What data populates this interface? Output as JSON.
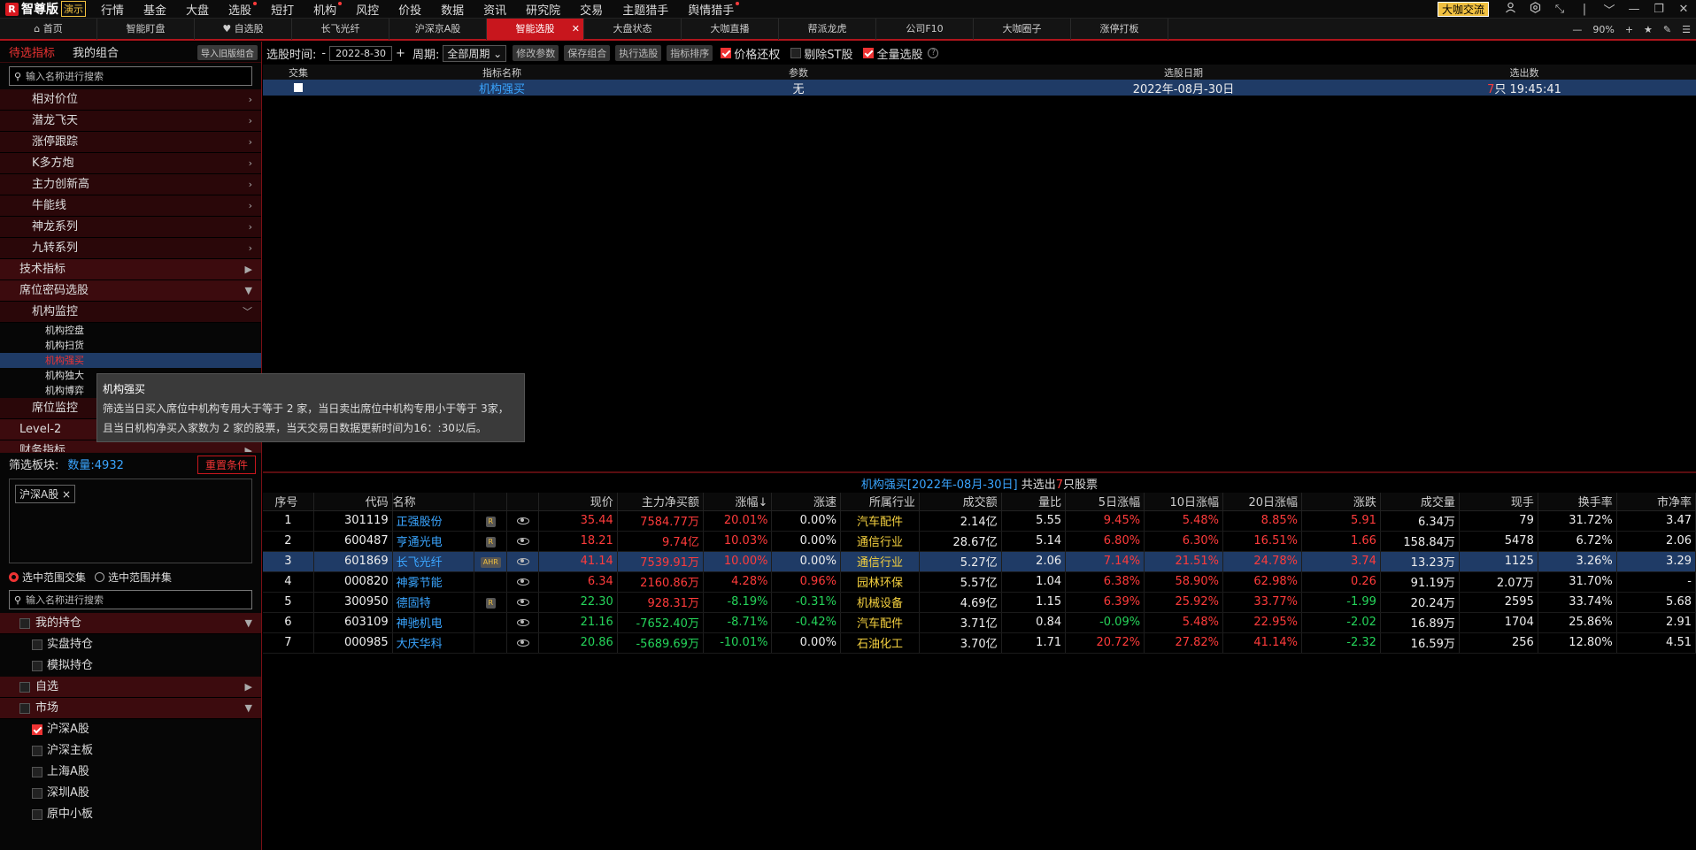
{
  "app": {
    "name": "智尊版",
    "demo_tag": "演示",
    "logo_letter": "R"
  },
  "menu": [
    {
      "label": "行情",
      "dot": false
    },
    {
      "label": "基金",
      "dot": false
    },
    {
      "label": "大盘",
      "dot": false
    },
    {
      "label": "选股",
      "dot": true
    },
    {
      "label": "短打",
      "dot": false
    },
    {
      "label": "机构",
      "dot": true
    },
    {
      "label": "风控",
      "dot": false
    },
    {
      "label": "价投",
      "dot": false
    },
    {
      "label": "数据",
      "dot": false
    },
    {
      "label": "资讯",
      "dot": false
    },
    {
      "label": "研究院",
      "dot": false
    },
    {
      "label": "交易",
      "dot": false
    },
    {
      "label": "主题猎手",
      "dot": false
    },
    {
      "label": "舆情猎手",
      "dot": true
    }
  ],
  "menu_right": {
    "exchange_btn": "大咖交流"
  },
  "tabs": [
    {
      "label": "首页",
      "icon": "home-icon"
    },
    {
      "label": "智能盯盘"
    },
    {
      "label": "自选股",
      "icon": "heart-icon"
    },
    {
      "label": "长飞光纤"
    },
    {
      "label": "沪深京A股"
    },
    {
      "label": "智能选股",
      "active": true
    },
    {
      "label": "大盘状态"
    },
    {
      "label": "大咖直播"
    },
    {
      "label": "帮派龙虎"
    },
    {
      "label": "公司F10"
    },
    {
      "label": "大咖圈子"
    },
    {
      "label": "涨停打板"
    }
  ],
  "tab_zoom": "90%",
  "sidebar": {
    "tab_pending": "待选指标",
    "tab_combo": "我的组合",
    "import_btn": "导入旧版组合",
    "search_placeholder": "输入名称进行搜索",
    "categories_top": [
      {
        "label": "相对价位",
        "arrow": ">"
      },
      {
        "label": "潜龙飞天",
        "arrow": ">"
      },
      {
        "label": "涨停跟踪",
        "arrow": ">"
      },
      {
        "label": "K多方炮",
        "arrow": ">"
      },
      {
        "label": "主力创新高",
        "arrow": ">"
      },
      {
        "label": "牛能线",
        "arrow": ">"
      },
      {
        "label": "神龙系列",
        "arrow": ">"
      },
      {
        "label": "九转系列",
        "arrow": ">"
      }
    ],
    "tech": "技术指标",
    "seat_code": "席位密码选股",
    "inst_monitor": "机构监控",
    "inst_leaves": [
      "机构控盘",
      "机构扫货",
      "机构强买",
      "机构独大",
      "机构博弈"
    ],
    "seat_monitor": "席位监控",
    "level2": "Level-2",
    "finance": "财务指标",
    "filter_label": "筛选板块:",
    "filter_count": "数量:4932",
    "reset_btn": "重置条件",
    "chip": "沪深A股",
    "radio_intersect": "选中范围交集",
    "radio_union": "选中范围并集",
    "search2_placeholder": "输入名称进行搜索",
    "my_holdings": "我的持仓",
    "holdings_leaves": [
      "实盘持仓",
      "模拟持仓"
    ],
    "watchlist": "自选",
    "market": "市场",
    "market_leaves": [
      {
        "label": "沪深A股",
        "checked": true
      },
      {
        "label": "沪深主板",
        "checked": false
      },
      {
        "label": "上海A股",
        "checked": false
      },
      {
        "label": "深圳A股",
        "checked": false
      },
      {
        "label": "原中小板",
        "checked": false
      }
    ]
  },
  "tooltip": {
    "title": "机构强买",
    "line1": "筛选当日买入席位中机构专用大于等于 2 家，当日卖出席位中机构专用小于等于 3家，",
    "line2": "且当日机构净买入家数为 2 家的股票，当天交易日数据更新时间为16：:30以后。"
  },
  "toolbar": {
    "date_label": "选股时间:",
    "minus": "-",
    "date": "2022-8-30",
    "plus": "+",
    "period_label": "周期:",
    "period": "全部周期",
    "btn_modify": "修改参数",
    "btn_save": "保存组合",
    "btn_exec": "执行选股",
    "btn_sort": "指标排序",
    "cb_price": "价格还权",
    "cb_st": "剔除ST股",
    "cb_all": "全量选股"
  },
  "ind_table": {
    "headers": [
      "交集",
      "指标名称",
      "参数",
      "选股日期",
      "选出数"
    ],
    "row": {
      "name": "机构强买",
      "param": "无",
      "date": "2022年-08月-30日",
      "count": "7",
      "count_suffix": "只 19:45:41"
    }
  },
  "result": {
    "title_a": "机构强买[2022年-08月-30日]",
    "title_b": " 共选出",
    "count": "7",
    "title_c": "只股票"
  },
  "stock_headers": [
    "序号",
    "代码",
    "名称",
    "",
    "",
    "现价",
    "主力净买额",
    "涨幅↓",
    "涨速",
    "所属行业",
    "成交额",
    "量比",
    "5日涨幅",
    "10日涨幅",
    "20日涨幅",
    "涨跌",
    "成交量",
    "现手",
    "换手率",
    "市净率"
  ],
  "stocks": [
    {
      "no": "1",
      "code": "301119",
      "name": "正强股份",
      "tag": "R",
      "price": "35.44",
      "net": "7584.77万",
      "chg": "20.01%",
      "speed": "0.00%",
      "ind": "汽车配件",
      "amt": "2.14亿",
      "vr": "5.55",
      "d5": "9.45%",
      "d10": "5.48%",
      "d20": "8.85%",
      "diff": "5.91",
      "vol": "6.34万",
      "hand": "79",
      "turn": "31.72%",
      "pb": "3.47",
      "c": {
        "price": "red",
        "net": "red",
        "chg": "red",
        "speed": "wht",
        "d5": "red",
        "d10": "red",
        "d20": "red",
        "diff": "red"
      }
    },
    {
      "no": "2",
      "code": "600487",
      "name": "亨通光电",
      "tag": "R",
      "price": "18.21",
      "net": "9.74亿",
      "chg": "10.03%",
      "speed": "0.00%",
      "ind": "通信行业",
      "amt": "28.67亿",
      "vr": "5.14",
      "d5": "6.80%",
      "d10": "6.30%",
      "d20": "16.51%",
      "diff": "1.66",
      "vol": "158.84万",
      "hand": "5478",
      "turn": "6.72%",
      "pb": "2.06",
      "c": {
        "price": "red",
        "net": "red",
        "chg": "red",
        "speed": "wht",
        "d5": "red",
        "d10": "red",
        "d20": "red",
        "diff": "red"
      }
    },
    {
      "no": "3",
      "code": "601869",
      "name": "长飞光纤",
      "tag": "AHR",
      "price": "41.14",
      "net": "7539.91万",
      "chg": "10.00%",
      "speed": "0.00%",
      "ind": "通信行业",
      "amt": "5.27亿",
      "vr": "2.06",
      "d5": "7.14%",
      "d10": "21.51%",
      "d20": "24.78%",
      "diff": "3.74",
      "vol": "13.23万",
      "hand": "1125",
      "turn": "3.26%",
      "pb": "3.29",
      "sel": true,
      "c": {
        "price": "red",
        "net": "red",
        "chg": "red",
        "speed": "wht",
        "d5": "red",
        "d10": "red",
        "d20": "red",
        "diff": "red"
      }
    },
    {
      "no": "4",
      "code": "000820",
      "name": "神雾节能",
      "tag": "",
      "price": "6.34",
      "net": "2160.86万",
      "chg": "4.28%",
      "speed": "0.96%",
      "ind": "园林环保",
      "amt": "5.57亿",
      "vr": "1.04",
      "d5": "6.38%",
      "d10": "58.90%",
      "d20": "62.98%",
      "diff": "0.26",
      "vol": "91.19万",
      "hand": "2.07万",
      "turn": "31.70%",
      "pb": "-",
      "c": {
        "price": "red",
        "net": "red",
        "chg": "red",
        "speed": "red",
        "d5": "red",
        "d10": "red",
        "d20": "red",
        "diff": "red"
      }
    },
    {
      "no": "5",
      "code": "300950",
      "name": "德固特",
      "tag": "R",
      "price": "22.30",
      "net": "928.31万",
      "chg": "-8.19%",
      "speed": "-0.31%",
      "ind": "机械设备",
      "amt": "4.69亿",
      "vr": "1.15",
      "d5": "6.39%",
      "d10": "25.92%",
      "d20": "33.77%",
      "diff": "-1.99",
      "vol": "20.24万",
      "hand": "2595",
      "turn": "33.74%",
      "pb": "5.68",
      "c": {
        "price": "grn",
        "net": "red",
        "chg": "grn",
        "speed": "grn",
        "d5": "red",
        "d10": "red",
        "d20": "red",
        "diff": "grn"
      }
    },
    {
      "no": "6",
      "code": "603109",
      "name": "神驰机电",
      "tag": "",
      "price": "21.16",
      "net": "-7652.40万",
      "chg": "-8.71%",
      "speed": "-0.42%",
      "ind": "汽车配件",
      "amt": "3.71亿",
      "vr": "0.84",
      "d5": "-0.09%",
      "d10": "5.48%",
      "d20": "22.95%",
      "diff": "-2.02",
      "vol": "16.89万",
      "hand": "1704",
      "turn": "25.86%",
      "pb": "2.91",
      "c": {
        "price": "grn",
        "net": "grn",
        "chg": "grn",
        "speed": "grn",
        "d5": "grn",
        "d10": "red",
        "d20": "red",
        "diff": "grn"
      }
    },
    {
      "no": "7",
      "code": "000985",
      "name": "大庆华科",
      "tag": "",
      "price": "20.86",
      "net": "-5689.69万",
      "chg": "-10.01%",
      "speed": "0.00%",
      "ind": "石油化工",
      "amt": "3.70亿",
      "vr": "1.71",
      "d5": "20.72%",
      "d10": "27.82%",
      "d20": "41.14%",
      "diff": "-2.32",
      "vol": "16.59万",
      "hand": "256",
      "turn": "12.80%",
      "pb": "4.51",
      "c": {
        "price": "grn",
        "net": "grn",
        "chg": "grn",
        "speed": "wht",
        "d5": "red",
        "d10": "red",
        "d20": "red",
        "diff": "grn"
      }
    }
  ],
  "colors": {
    "accent": "#c8161d",
    "up": "#ff3b3b",
    "down": "#25d45a",
    "link": "#3aa5ff",
    "select": "#1f3b66"
  }
}
